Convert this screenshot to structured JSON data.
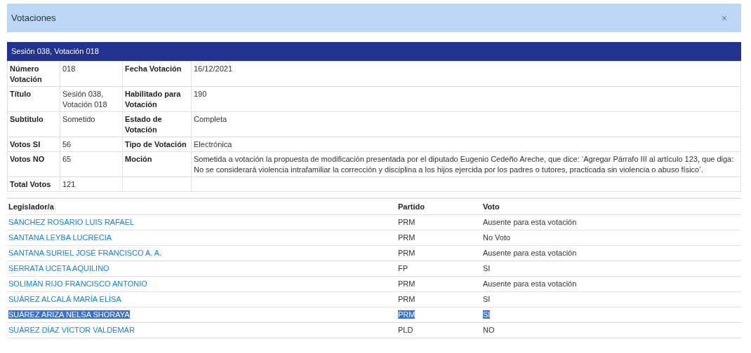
{
  "modal": {
    "title": "Votaciones",
    "close": "×"
  },
  "session": {
    "title": "Sesión 038, Votación 018",
    "details": [
      {
        "label": "Número Votación",
        "value": "018",
        "label_2": "Fecha Votación",
        "value_2": "16/12/2021"
      },
      {
        "label": "Título",
        "value": "Sesión 038, Votación 018",
        "label_2": "Habilitado para Votación",
        "value_2": "190"
      },
      {
        "label": "Subtitulo",
        "value": "Sometido",
        "label_2": "Estado de Votación",
        "value_2": "Completa"
      },
      {
        "label": "Votos SI",
        "value": "56",
        "label_2": "Tipo de Votación",
        "value_2": "Electrónica"
      },
      {
        "label": "Votos NO",
        "value": "65",
        "label_2": "Moción",
        "value_2": "Sometida a votación la propuesta de modificación presentada por el diputado Eugenio Cedeño Areche, que dice: ‘Agregar Párrafo III al artículo 123, que diga: No se considerará violencia intrafamiliar la corrección y disciplina a los hijos ejercida por los padres o tutores, practicada sin violencia o abuso físico’."
      },
      {
        "label": "Total Votos",
        "value": "121"
      }
    ]
  },
  "votes": {
    "columns": [
      "Legislador/a",
      "Partido",
      "Voto"
    ],
    "rows": [
      {
        "legislator": "SÁNCHEZ ROSARIO LUIS RAFAEL",
        "party": "PRM",
        "vote": "Ausente para esta votación",
        "selected": false
      },
      {
        "legislator": "SANTANA LEYBA LUCRECIA",
        "party": "PRM",
        "vote": "No Voto",
        "selected": false
      },
      {
        "legislator": "SANTANA SURIEL JOSÉ FRANCISCO A. A.",
        "party": "PRM",
        "vote": "Ausente para esta votación",
        "selected": false
      },
      {
        "legislator": "SERRATA UCETA AQUILINO",
        "party": "FP",
        "vote": "SI",
        "selected": false
      },
      {
        "legislator": "SOLIMÁN RIJO FRANCISCO ANTONIO",
        "party": "PRM",
        "vote": "Ausente para esta votación",
        "selected": false
      },
      {
        "legislator": "SUÁREZ ALCALÁ MARÍA ELISA",
        "party": "PRM",
        "vote": "SI",
        "selected": false
      },
      {
        "legislator": "SUÁREZ ARIZA NELSA SHORAYA",
        "party": "PRM",
        "vote": "SI",
        "selected": true
      },
      {
        "legislator": "SUÁREZ DÍAZ VÍCTOR VALDEMAR",
        "party": "PLD",
        "vote": "NO",
        "selected": false
      }
    ]
  }
}
